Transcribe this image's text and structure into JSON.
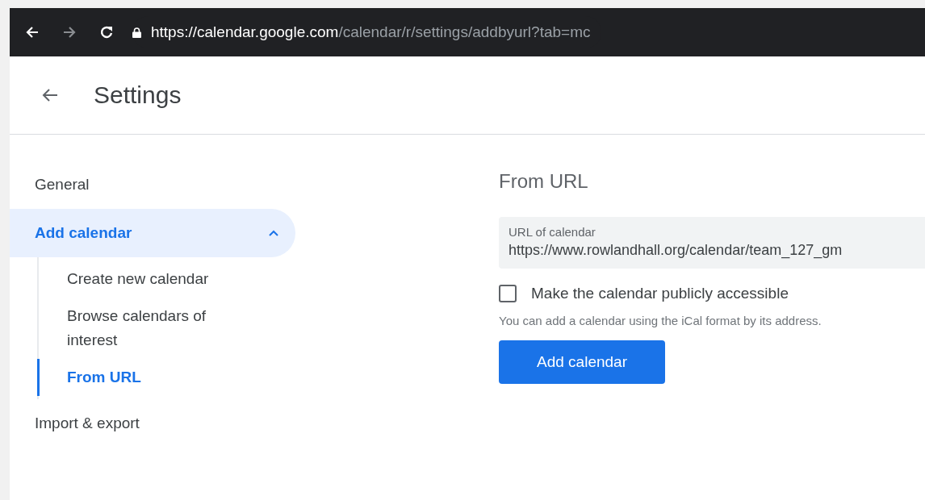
{
  "browser": {
    "url_host": "https://calendar.google.com",
    "url_path": "/calendar/r/settings/addbyurl?tab=mc"
  },
  "header": {
    "title": "Settings"
  },
  "sidebar": {
    "items": [
      {
        "label": "General",
        "selected": false
      },
      {
        "label": "Add calendar",
        "selected": true,
        "expanded": true,
        "children": [
          {
            "label": "Create new calendar",
            "selected": false
          },
          {
            "label": "Browse calendars of interest",
            "selected": false
          },
          {
            "label": "From URL",
            "selected": true
          }
        ]
      },
      {
        "label": "Import & export",
        "selected": false
      }
    ]
  },
  "content": {
    "heading": "From URL",
    "field": {
      "label": "URL of calendar",
      "value": "https://www.rowlandhall.org/calendar/team_127_gm"
    },
    "checkbox": {
      "label": "Make the calendar publicly accessible",
      "checked": false
    },
    "hint": "You can add a calendar using the iCal format by its address.",
    "button": "Add calendar"
  }
}
